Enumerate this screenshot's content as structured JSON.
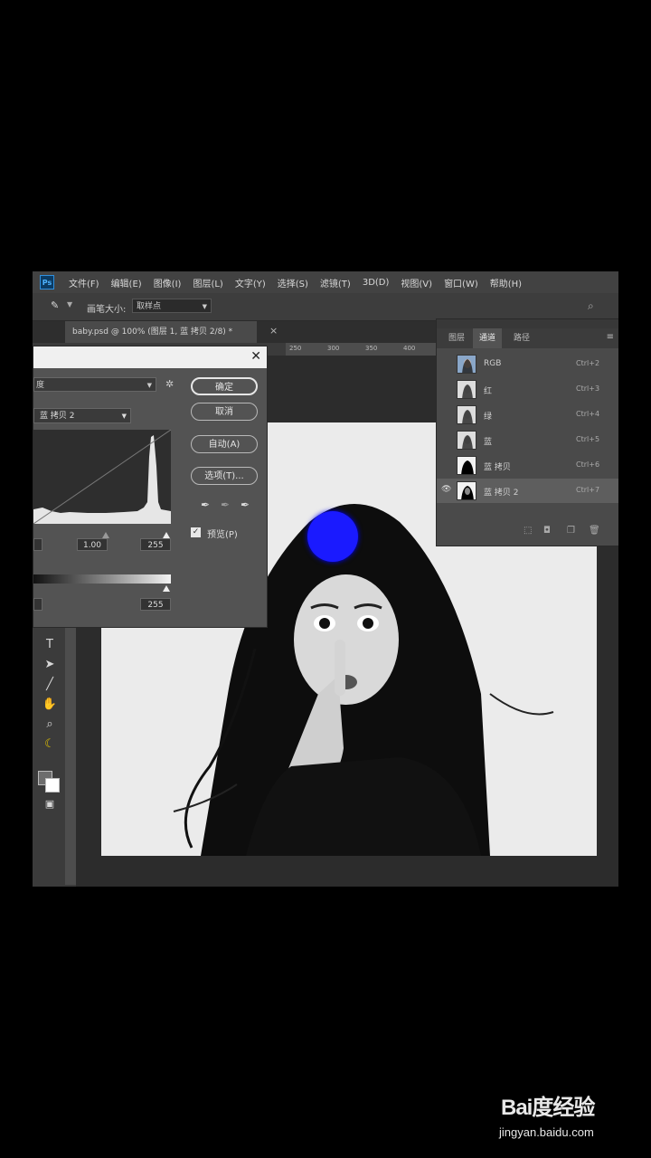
{
  "app": {
    "logo": "Ps"
  },
  "menu": [
    "文件(F)",
    "编辑(E)",
    "图像(I)",
    "图层(L)",
    "文字(Y)",
    "选择(S)",
    "滤镜(T)",
    "3D(D)",
    "视图(V)",
    "窗口(W)",
    "帮助(H)"
  ],
  "options_bar": {
    "tool_icon": "brush-icon",
    "size_label": "画笔大小:",
    "sample_select": "取样点"
  },
  "document_tab": {
    "title": "baby.psd @ 100% (图层 1, 蓝 拷贝 2/8) *",
    "close": "×"
  },
  "ruler_top": [
    "250",
    "300",
    "350",
    "400"
  ],
  "curves_dialog": {
    "close": "✕",
    "preset_value": "度",
    "channel_value": "蓝 拷贝 2",
    "input_black": "",
    "input_gamma": "1.00",
    "input_white": "255",
    "output_black": "",
    "output_white": "255",
    "buttons": {
      "ok": "确定",
      "cancel": "取消",
      "auto": "自动(A)",
      "options": "选项(T)..."
    },
    "preview_label": "预览(P)",
    "preview_checked": true
  },
  "channels_panel": {
    "tabs": [
      "图层",
      "通道",
      "路径"
    ],
    "active_tab": 1,
    "menu_icon": "≡",
    "channels": [
      {
        "name": "RGB",
        "shortcut": "Ctrl+2",
        "visible": false,
        "active": false,
        "thumb": "color"
      },
      {
        "name": "红",
        "shortcut": "Ctrl+3",
        "visible": false,
        "active": false,
        "thumb": "gray"
      },
      {
        "name": "绿",
        "shortcut": "Ctrl+4",
        "visible": false,
        "active": false,
        "thumb": "gray"
      },
      {
        "name": "蓝",
        "shortcut": "Ctrl+5",
        "visible": false,
        "active": false,
        "thumb": "gray"
      },
      {
        "name": "蓝 拷贝",
        "shortcut": "Ctrl+6",
        "visible": false,
        "active": false,
        "thumb": "mask"
      },
      {
        "name": "蓝 拷贝 2",
        "shortcut": "Ctrl+7",
        "visible": true,
        "active": true,
        "thumb": "mask"
      }
    ]
  },
  "watermark": {
    "logo": "Bai度经验",
    "url": "jingyan.baidu.com"
  },
  "colors": {
    "brush_cursor": "#1a1aff",
    "accent": "#2f8fde"
  }
}
